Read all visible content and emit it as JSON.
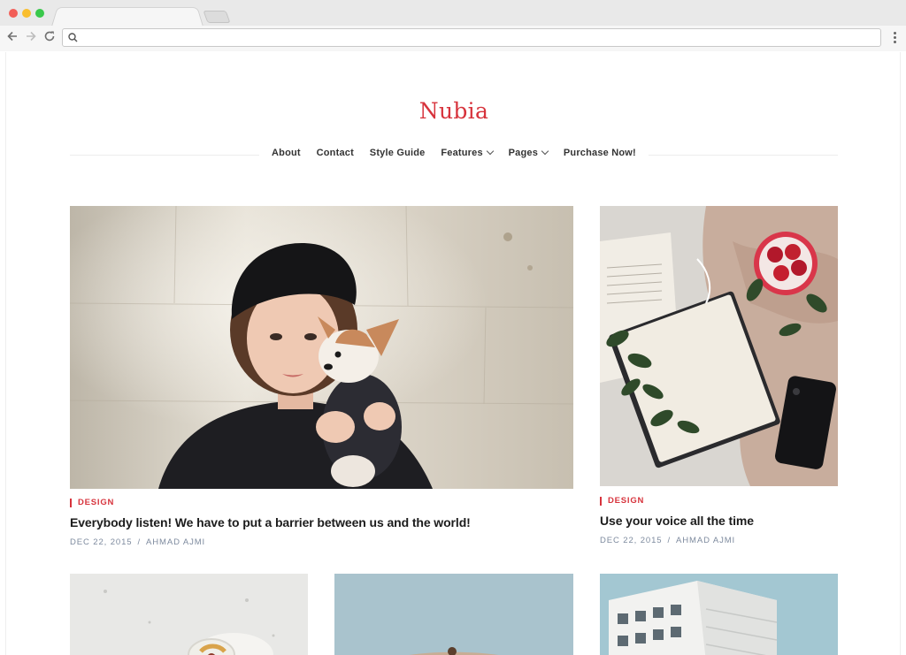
{
  "browser": {
    "url": "",
    "icons": {
      "back": "arrow-left-icon",
      "forward": "arrow-right-icon",
      "reload": "reload-icon",
      "search": "search-icon",
      "menu": "kebab-menu-icon"
    }
  },
  "site": {
    "title": "Nubia",
    "accent_color": "#d7333c"
  },
  "menu": {
    "items": [
      {
        "label": "About"
      },
      {
        "label": "Contact"
      },
      {
        "label": "Style Guide"
      },
      {
        "label": "Features"
      },
      {
        "label": "Pages"
      },
      {
        "label": "Purchase Now!"
      }
    ]
  },
  "posts": [
    {
      "category": "DESIGN",
      "title": "Everybody listen! We have to put a barrier between us and the world!",
      "date": "DEC 22, 2015",
      "separator": "/",
      "author": "AHMAD AJMI"
    },
    {
      "category": "DESIGN",
      "title": "Use your voice all the time",
      "date": "DEC 22, 2015",
      "separator": "/",
      "author": "AHMAD AJMI"
    }
  ]
}
